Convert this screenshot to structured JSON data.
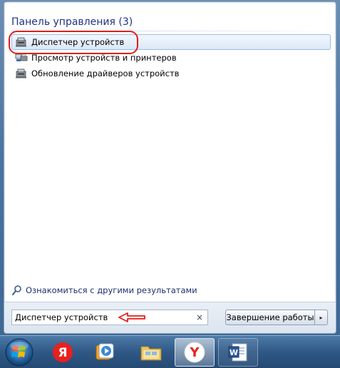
{
  "start_menu": {
    "group_header": "Панель управления (3)",
    "results": [
      {
        "label": "Диспетчер устройств",
        "icon": "device-manager-icon",
        "selected": true
      },
      {
        "label": "Просмотр устройств и принтеров",
        "icon": "devices-printers-icon",
        "selected": false
      },
      {
        "label": "Обновление драйверов устройств",
        "icon": "driver-update-icon",
        "selected": false
      }
    ],
    "see_more_label": "Ознакомиться с другими результатами",
    "search": {
      "value": "Диспетчер устройств",
      "clear_glyph": "×"
    },
    "shutdown_label": "Завершение работы",
    "shutdown_arrow_glyph": "▸",
    "annotation_color": "#e31d1d"
  },
  "taskbar": {
    "items": [
      {
        "name": "start-orb",
        "icon": "windows-logo-icon"
      },
      {
        "name": "yandex-icon",
        "icon": "yandex-letter-icon",
        "glyph": "Я"
      },
      {
        "name": "media-player-icon",
        "icon": "media-player-icon"
      },
      {
        "name": "explorer-icon",
        "icon": "folder-icon"
      },
      {
        "name": "yandex-browser-icon",
        "icon": "yandex-browser-icon",
        "glyph": "Y",
        "active": true
      },
      {
        "name": "word-icon",
        "icon": "word-icon",
        "glyph": "W"
      }
    ]
  }
}
